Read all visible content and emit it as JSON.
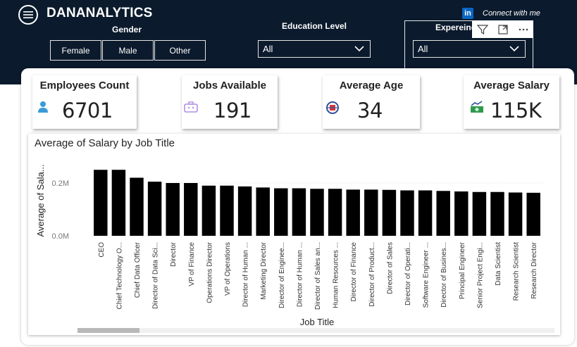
{
  "header": {
    "brand": "DANANALYTICS",
    "linkedin": {
      "icon": "in",
      "text": "Connect with me"
    }
  },
  "filters": {
    "gender": {
      "label": "Gender",
      "options": [
        "Female",
        "Male",
        "Other"
      ]
    },
    "education": {
      "label": "Education Level",
      "selected": "All"
    },
    "experience": {
      "label": "Expereince",
      "selected": "All"
    }
  },
  "kpis": {
    "employees": {
      "title": "Employees Count",
      "value": "6701",
      "icon": "person-icon",
      "color": "#3a9ad9"
    },
    "jobs": {
      "title": "Jobs Available",
      "value": "191",
      "icon": "briefcase-icon",
      "color": "#b08fe0"
    },
    "age": {
      "title": "Average Age",
      "value": "34",
      "icon": "age-icon",
      "color": "#2f4fa0"
    },
    "salary": {
      "title": "Average Salary",
      "value": "115K",
      "icon": "money-icon",
      "color": "#2e9a4b"
    }
  },
  "chart_data": {
    "type": "bar",
    "title": "Average of Salary by Job Title",
    "xlabel": "Job Title",
    "ylabel": "Average of Sala...",
    "ylim": [
      0,
      0.28
    ],
    "yticks": [
      "0.0M",
      "0.2M"
    ],
    "grid": true,
    "bar_color": "#000000",
    "categories": [
      "CEO",
      "Chief Technology O...",
      "Chief Data Officer",
      "Director of Data Sci...",
      "Director",
      "VP of Finance",
      "Operations Director",
      "VP of Operations",
      "Director of Human ...",
      "Marketing Director",
      "Director of Enginee...",
      "Director of Human ...",
      "Director of Sales an...",
      "Human Resources ...",
      "Director of Finance",
      "Director of Product...",
      "Director of Sales",
      "Director of Operati...",
      "Software Engineer ...",
      "Director of Busines...",
      "Principal Engineer",
      "Senior Project Engi...",
      "Data Scientist",
      "Research Scientist",
      "Research Director"
    ],
    "values": [
      0.25,
      0.25,
      0.22,
      0.205,
      0.2,
      0.2,
      0.19,
      0.19,
      0.187,
      0.183,
      0.18,
      0.18,
      0.178,
      0.178,
      0.175,
      0.175,
      0.174,
      0.172,
      0.172,
      0.17,
      0.168,
      0.166,
      0.166,
      0.164,
      0.163
    ]
  }
}
